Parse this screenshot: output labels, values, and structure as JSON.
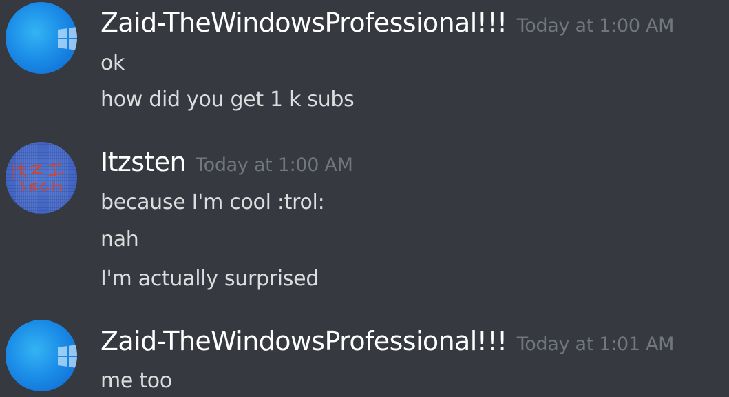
{
  "messages": [
    {
      "username": "Zaid-TheWindowsProfessional!!!",
      "timestamp": "Today at 1:00 AM",
      "lines": [
        "ok",
        "how did you get 1 k subs"
      ]
    },
    {
      "username": "Itzsten",
      "timestamp": "Today at 1:00 AM",
      "lines": [
        "because I'm cool :trol:",
        "nah",
        "I'm actually surprised"
      ]
    },
    {
      "username": "Zaid-TheWindowsProfessional!!!",
      "timestamp": "Today at 1:01 AM",
      "lines": [
        "me too"
      ]
    }
  ],
  "avatar_icons": [
    "windows-logo-icon",
    "itzsten-handwritten-avatar",
    "windows-logo-icon"
  ],
  "colors": {
    "background": "#36393f",
    "username": "#ffffff",
    "timestamp": "#72767d",
    "message_text": "#dcddde"
  }
}
